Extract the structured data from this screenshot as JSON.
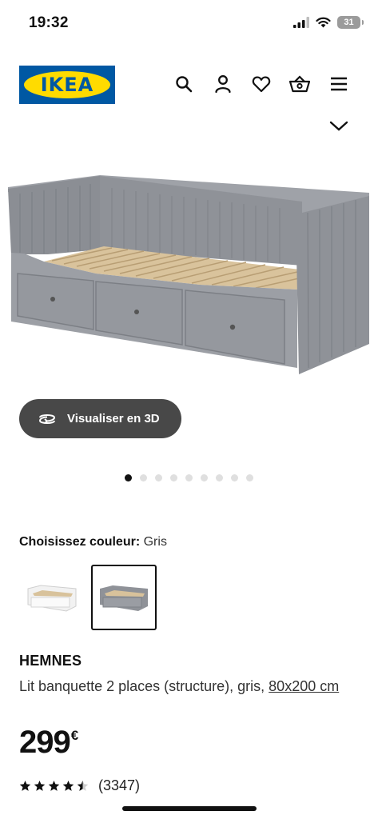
{
  "status_bar": {
    "time": "19:32",
    "battery": "31"
  },
  "header": {
    "logo_text": "IKEA",
    "icons": [
      "search-icon",
      "user-icon",
      "heart-icon",
      "basket-icon",
      "menu-icon"
    ]
  },
  "gallery": {
    "visualize_label": "Visualiser en 3D",
    "dot_count": 9,
    "active_dot": 1
  },
  "color": {
    "label": "Choisissez couleur:",
    "value": "Gris",
    "options": [
      "white",
      "grey"
    ],
    "selected": "grey"
  },
  "product": {
    "name": "HEMNES",
    "description": "Lit banquette 2 places (structure), gris,",
    "size": "80x200 cm",
    "price": "299",
    "currency": "€",
    "rating": 4.5,
    "review_count": "(3347)"
  },
  "colors": {
    "brand_blue": "#0058A3",
    "brand_yellow": "#FFDB00",
    "button_dark": "#484848",
    "frame_grey": "#8e9197"
  }
}
